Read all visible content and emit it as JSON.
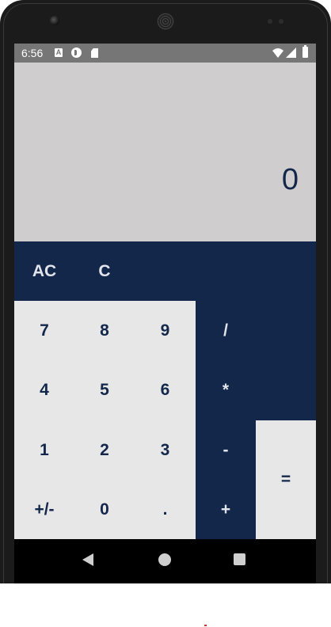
{
  "status_bar": {
    "time": "6:56",
    "icons": [
      "a-notification-icon",
      "p-notification-icon",
      "sd-card-icon",
      "wifi-icon",
      "cell-signal-icon",
      "battery-icon"
    ]
  },
  "display": {
    "value": "0"
  },
  "keys": {
    "ac": "AC",
    "c": "C",
    "seven": "7",
    "eight": "8",
    "nine": "9",
    "divide": "/",
    "four": "4",
    "five": "5",
    "six": "6",
    "multiply": "*",
    "one": "1",
    "two": "2",
    "three": "3",
    "minus": "-",
    "negate": "+/-",
    "zero": "0",
    "decimal": ".",
    "plus": "+",
    "equals": "="
  },
  "colors": {
    "display_bg": "#cfcdce",
    "accent_dark": "#13274a",
    "key_light_bg": "#e7e7e8",
    "status_bar_bg": "#767676"
  }
}
